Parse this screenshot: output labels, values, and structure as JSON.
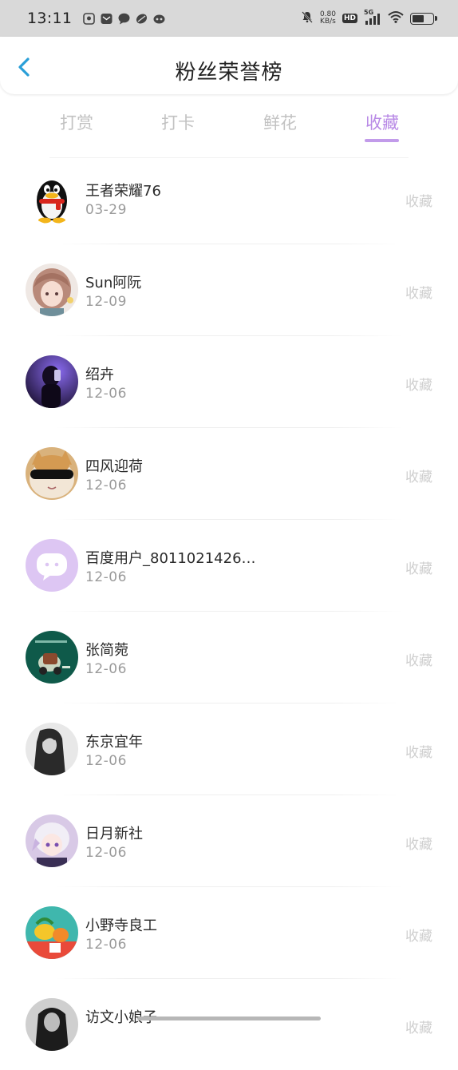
{
  "status_bar": {
    "time": "13:11",
    "net_speed_value": "0.80",
    "net_speed_unit": "KB/s",
    "hd_label": "HD",
    "network_label": "5G"
  },
  "header": {
    "title": "粉丝荣誉榜"
  },
  "tabs": [
    {
      "label": "打赏",
      "active": false
    },
    {
      "label": "打卡",
      "active": false
    },
    {
      "label": "鲜花",
      "active": false
    },
    {
      "label": "收藏",
      "active": true
    }
  ],
  "colors": {
    "accent": "#b889e6",
    "inactive_tab": "#c2c2c2",
    "date": "#9a9a9a",
    "action": "#cfcfcf"
  },
  "users": [
    {
      "name": "王者荣耀76",
      "date": "03-29",
      "action": "收藏",
      "avatar": "penguin-avatar"
    },
    {
      "name": "Sun阿阮",
      "date": "12-09",
      "action": "收藏",
      "avatar": "anime-girl-avatar"
    },
    {
      "name": "绍卉",
      "date": "12-06",
      "action": "收藏",
      "avatar": "purple-photo-avatar"
    },
    {
      "name": "四风迎荷",
      "date": "12-06",
      "action": "收藏",
      "avatar": "cat-sunglasses-avatar"
    },
    {
      "name": "百度用户_8011021426…",
      "date": "12-06",
      "action": "收藏",
      "avatar": "chat-bubble-avatar"
    },
    {
      "name": "张简菀",
      "date": "12-06",
      "action": "收藏",
      "avatar": "green-illustration-avatar"
    },
    {
      "name": "东京宜年",
      "date": "12-06",
      "action": "收藏",
      "avatar": "bw-portrait-avatar"
    },
    {
      "name": "日月新社",
      "date": "12-06",
      "action": "收藏",
      "avatar": "anime-boy-avatar"
    },
    {
      "name": "小野寺良工",
      "date": "12-06",
      "action": "收藏",
      "avatar": "fruit-avatar"
    },
    {
      "name": "访文小娘子",
      "date": "",
      "action": "收藏",
      "avatar": "dark-portrait-avatar"
    }
  ]
}
